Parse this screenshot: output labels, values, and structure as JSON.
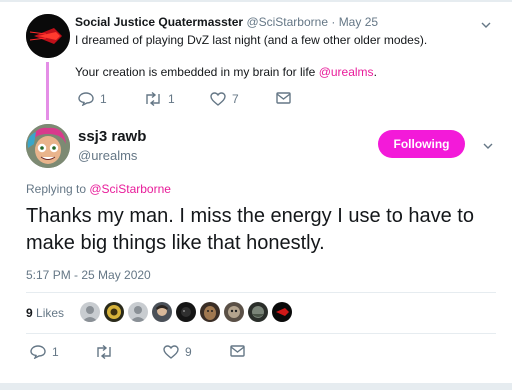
{
  "parent": {
    "name": "Social Justice Quatermasster",
    "handle": "@SciStarborne",
    "dot": "·",
    "date": "May 25",
    "line1": "I dreamed of playing DvZ last night (and a few other older modes).",
    "line2_prefix": "Your creation is embedded in my brain for life ",
    "line2_mention": "@urealms",
    "line2_suffix": ".",
    "replies": "1",
    "retweets": "1",
    "likes": "7"
  },
  "main": {
    "name": "ssj3 rawb",
    "handle": "@urealms",
    "follow_label": "Following",
    "replying_prefix": "Replying to ",
    "replying_mention": "@SciStarborne",
    "text": "Thanks my man. I miss the energy I use to have to make big things like that honestly.",
    "timestamp": "5:17 PM - 25 May 2020",
    "likes_count": "9",
    "likes_label": "Likes",
    "replies": "1",
    "retweets": "",
    "like_count_bottom": "9"
  },
  "colors": {
    "accent": "#f31ad9",
    "mention": "#e81c9a",
    "muted": "#657786",
    "thread_line": "#e48ee6"
  },
  "icons": [
    "chevron-down-icon",
    "reply-icon",
    "retweet-icon",
    "heart-icon",
    "dm-icon"
  ]
}
